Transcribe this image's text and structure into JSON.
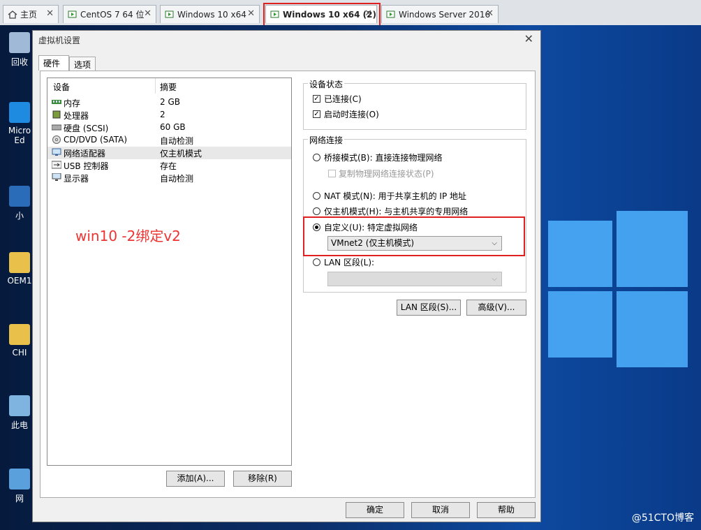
{
  "tabs": [
    {
      "label": "主页"
    },
    {
      "label": "CentOS 7 64 位"
    },
    {
      "label": "Windows 10 x64"
    },
    {
      "label": "Windows 10 x64 (2)"
    },
    {
      "label": "Windows Server 2016"
    }
  ],
  "desktop_icons": [
    {
      "label": "回收"
    },
    {
      "label": "Micro Ed"
    },
    {
      "label": "小"
    },
    {
      "label": "OEM1"
    },
    {
      "label": "CHI"
    },
    {
      "label": "此电"
    },
    {
      "label": "网"
    }
  ],
  "dialog": {
    "title": "虚拟机设置",
    "tabs": [
      "硬件",
      "选项"
    ],
    "device_header": {
      "device": "设备",
      "summary": "摘要"
    },
    "devices": [
      {
        "name": "内存",
        "summary": "2 GB",
        "icon": "memory-icon"
      },
      {
        "name": "处理器",
        "summary": "2",
        "icon": "cpu-icon"
      },
      {
        "name": "硬盘 (SCSI)",
        "summary": "60 GB",
        "icon": "harddisk-icon"
      },
      {
        "name": "CD/DVD (SATA)",
        "summary": "自动检测",
        "icon": "cd-icon"
      },
      {
        "name": "网络适配器",
        "summary": "仅主机模式",
        "icon": "network-icon"
      },
      {
        "name": "USB 控制器",
        "summary": "存在",
        "icon": "usb-icon"
      },
      {
        "name": "显示器",
        "summary": "自动检测",
        "icon": "monitor-icon"
      }
    ],
    "add_button": "添加(A)...",
    "remove_button": "移除(R)",
    "device_status": {
      "title": "设备状态",
      "connected": "已连接(C)",
      "connect_on_power": "启动时连接(O)"
    },
    "network": {
      "title": "网络连接",
      "bridged": "桥接模式(B): 直接连接物理网络",
      "replicate": "复制物理网络连接状态(P)",
      "nat": "NAT 模式(N): 用于共享主机的 IP 地址",
      "host_only": "仅主机模式(H): 与主机共享的专用网络",
      "custom": "自定义(U): 特定虚拟网络",
      "custom_value": "VMnet2 (仅主机模式)",
      "lan": "LAN 区段(L):",
      "lan_value": ""
    },
    "lan_segments_button": "LAN 区段(S)...",
    "advanced_button": "高级(V)...",
    "ok": "确定",
    "cancel": "取消",
    "help": "帮助"
  },
  "annotation": "win10 -2绑定v2",
  "watermark": "@51CTO博客",
  "colors": {
    "annotation": "#e33333",
    "accent_red_box": "#e02020"
  }
}
